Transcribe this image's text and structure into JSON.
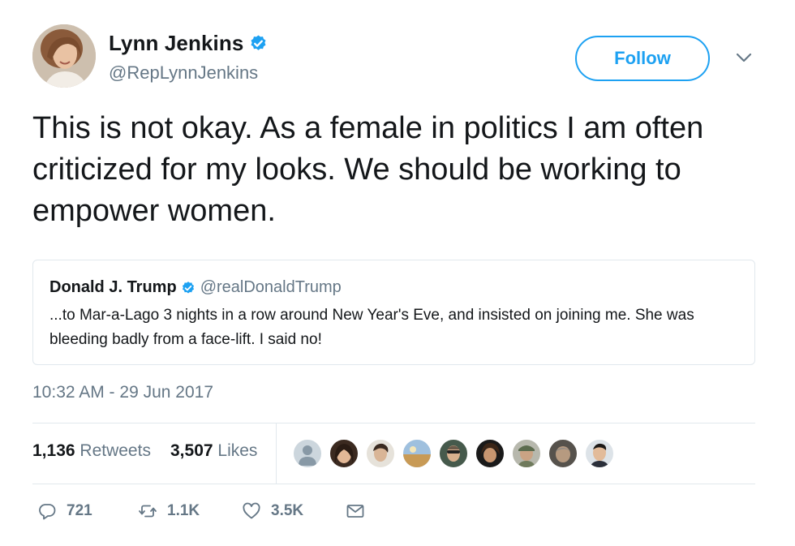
{
  "author": {
    "display_name": "Lynn Jenkins",
    "handle": "@RepLynnJenkins",
    "verified": true,
    "avatar_icon": "profile-photo"
  },
  "follow_label": "Follow",
  "tweet_text": "This is not okay. As a female in politics I am often criticized for my looks. We should be working to empower women.",
  "quoted_tweet": {
    "display_name": "Donald J. Trump",
    "handle": "@realDonaldTrump",
    "verified": true,
    "text": "...to Mar-a-Lago 3 nights in a row around New Year's Eve, and insisted on joining me. She was bleeding badly from a face-lift. I said no!"
  },
  "timestamp": "10:32 AM - 29 Jun 2017",
  "stats": {
    "retweets_count": "1,136",
    "retweets_label": "Retweets",
    "likes_count": "3,507",
    "likes_label": "Likes"
  },
  "actions": {
    "reply_count": "721",
    "retweet_count": "1.1K",
    "like_count": "3.5K"
  },
  "colors": {
    "accent": "#1da1f2",
    "muted": "#657786",
    "text": "#14171a",
    "border": "#e1e8ed"
  }
}
